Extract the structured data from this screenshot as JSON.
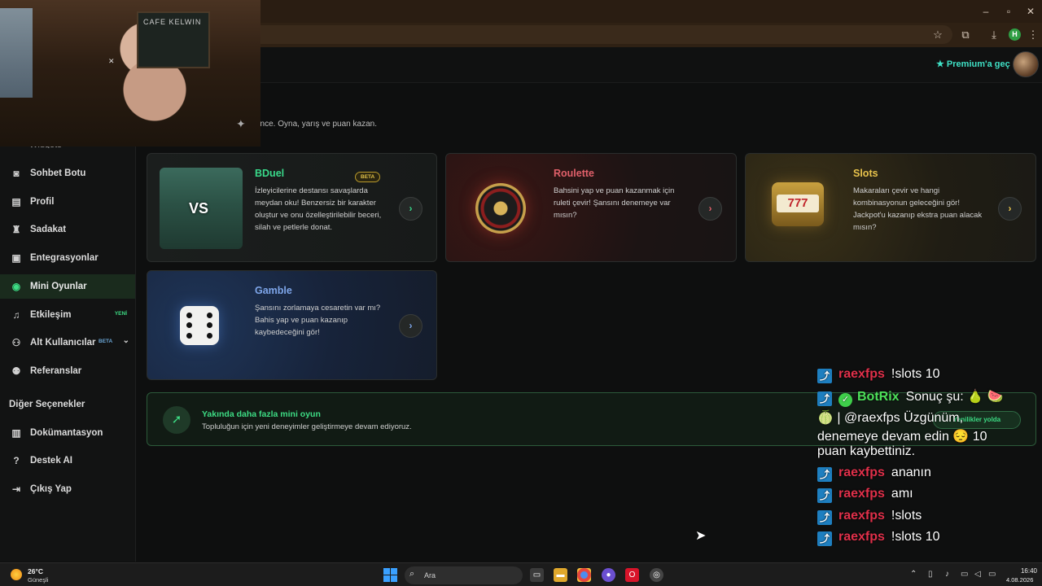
{
  "header": {
    "premium_label": "Premium'a geç"
  },
  "page": {
    "subtitle": "ence. Oyna, yarış ve puan kazan."
  },
  "webcam": {
    "sign_text": "CAFE KELWIN"
  },
  "sidebar": {
    "partial_item": "Widgets",
    "items": [
      {
        "label": "Sohbet Botu",
        "icon": "robot-icon"
      },
      {
        "label": "Profil",
        "icon": "id-card-icon"
      },
      {
        "label": "Sadakat",
        "icon": "trophy-icon"
      },
      {
        "label": "Entegrasyonlar",
        "icon": "plug-icon"
      },
      {
        "label": "Mini Oyunlar",
        "icon": "gamepad-icon",
        "active": true
      },
      {
        "label": "Etkileşim",
        "icon": "music-icon",
        "badge": "YENİ"
      },
      {
        "label": "Alt Kullanıcılar",
        "icon": "users-icon",
        "badge": "BETA"
      },
      {
        "label": "Referanslar",
        "icon": "user-group-icon"
      }
    ],
    "section_other": "Diğer Seçenekler",
    "other_items": [
      {
        "label": "Dokümantasyon",
        "icon": "book-icon"
      },
      {
        "label": "Destek AI",
        "icon": "help-icon"
      },
      {
        "label": "Çıkış Yap",
        "icon": "logout-icon"
      }
    ]
  },
  "games": [
    {
      "title": "BDuel",
      "badge": "BETA",
      "description": "İzleyicilerine destansı savaşlarda meydan oku! Benzersiz bir karakter oluştur ve onu özelleştirilebilir beceri, silah ve petlerle donat.",
      "thumb_text": "VS"
    },
    {
      "title": "Roulette",
      "description": "Bahsini yap ve puan kazanmak için ruleti çevir! Şansını denemeye var mısın?"
    },
    {
      "title": "Slots",
      "description": "Makaraları çevir ve hangi kombinasyonun geleceğini gör! Jackpot'u kazanıp ekstra puan alacak mısın?",
      "thumb_text": "777"
    },
    {
      "title": "Gamble",
      "description": "Şansını zorlamaya cesaretin var mı? Bahis yap ve puan kazanıp kaybedeceğini gör!"
    }
  ],
  "banner": {
    "title": "Yakında daha fazla mini oyun",
    "text": "Topluluğun için yeni deneyimler geliştirmeye devam ediyoruz.",
    "pill": "Yenilikler yolda"
  },
  "chat": [
    {
      "user": "raexfps",
      "message": "!slots 10"
    },
    {
      "user": "BotRix",
      "message": "Sonuç şu: 🍐 🍉",
      "bot": true
    },
    {
      "message": "🍈 | @raexfps Üzgünüm,"
    },
    {
      "message": "denemeye devam edin 😔 10"
    },
    {
      "message": "puan kaybettiniz."
    },
    {
      "user": "raexfps",
      "message": "ananın"
    },
    {
      "user": "raexfps",
      "message": "amı"
    },
    {
      "user": "raexfps",
      "message": "!slots"
    },
    {
      "user": "raexfps",
      "message": "!slots 10"
    }
  ],
  "taskbar": {
    "weather_temp": "26°C",
    "weather_desc": "Güneşli",
    "search_placeholder": "Ara",
    "time": "16:40",
    "date": "4.08.2026"
  },
  "colors": {
    "accent": "#3ddc84",
    "roulette": "#e0606a",
    "slots": "#e8c34c",
    "gamble": "#7ea6ea",
    "chat_user": "#e0304a"
  }
}
